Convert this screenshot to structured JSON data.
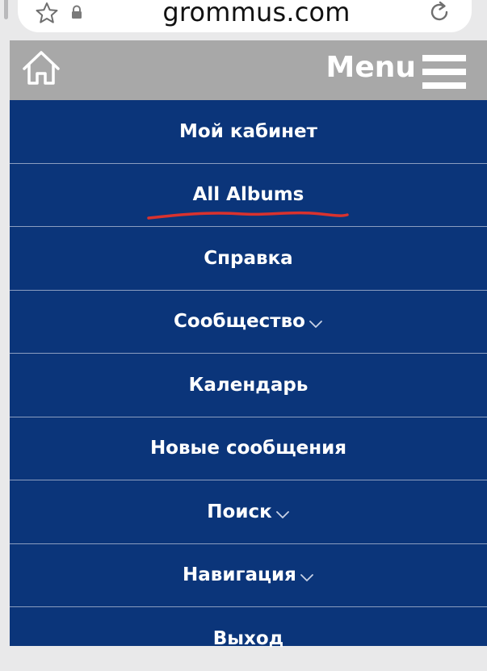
{
  "browser": {
    "url": "grommus.com",
    "icons": [
      "star-icon",
      "lock-icon",
      "reload-icon"
    ]
  },
  "header": {
    "menu_label": "Menu",
    "icons": [
      "home-icon",
      "hamburger-icon"
    ],
    "background": "#a8a8a8"
  },
  "nav": {
    "background": "#0b357a",
    "items": [
      {
        "label": "Мой кабинет",
        "has_dropdown": false
      },
      {
        "label": "All Albums",
        "has_dropdown": false
      },
      {
        "label": "Справка",
        "has_dropdown": false
      },
      {
        "label": "Сообщество",
        "has_dropdown": true
      },
      {
        "label": "Календарь",
        "has_dropdown": false
      },
      {
        "label": "Новые сообщения",
        "has_dropdown": false
      },
      {
        "label": "Поиск",
        "has_dropdown": true
      },
      {
        "label": "Навигация",
        "has_dropdown": true
      },
      {
        "label": "Выход",
        "has_dropdown": false
      }
    ]
  },
  "annotation": {
    "type": "hand-drawn underline",
    "color": "#d9322e",
    "target": "All Albums"
  }
}
